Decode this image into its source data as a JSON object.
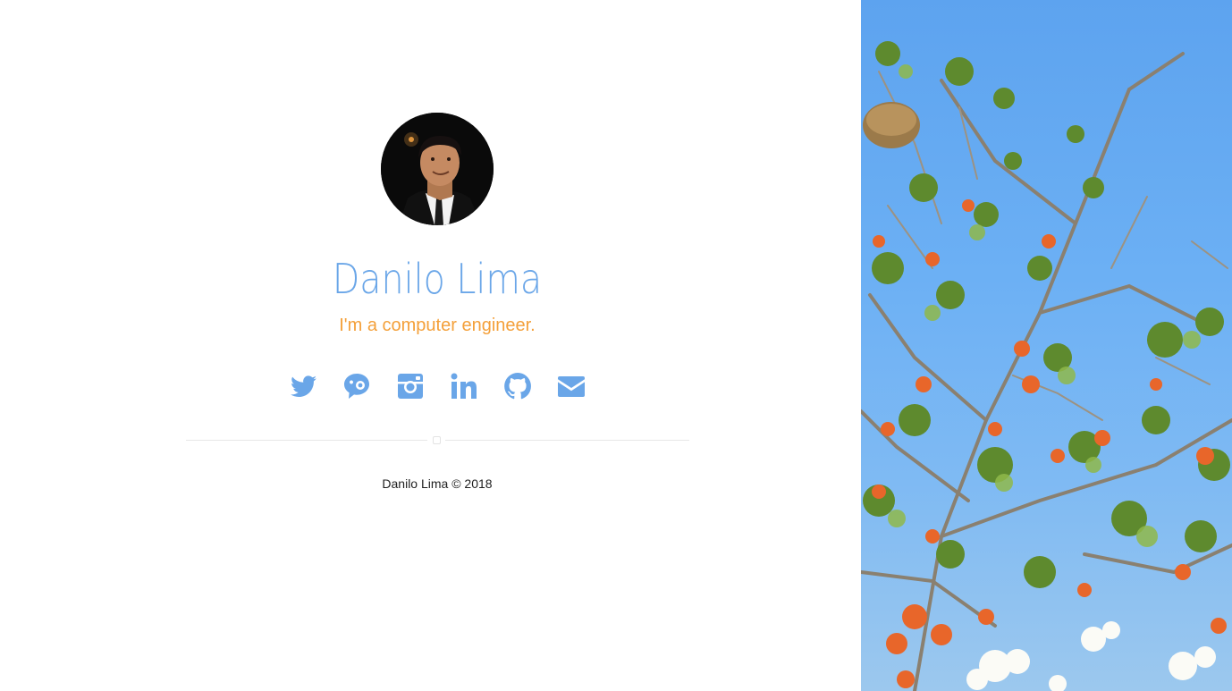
{
  "profile": {
    "name": "Danilo Lima",
    "tagline": "I'm a computer engineer.",
    "avatar_icon": "profile-photo"
  },
  "social": [
    {
      "name": "twitter",
      "icon": "twitter-icon"
    },
    {
      "name": "keybase",
      "icon": "keybase-icon"
    },
    {
      "name": "instagram",
      "icon": "instagram-icon"
    },
    {
      "name": "linkedin",
      "icon": "linkedin-icon"
    },
    {
      "name": "github",
      "icon": "github-icon"
    },
    {
      "name": "email",
      "icon": "envelope-icon"
    }
  ],
  "footer": {
    "text": "Danilo Lima © 2018"
  },
  "colors": {
    "accent": "#6aa6e8",
    "tagline": "#f4a03a",
    "sky": "#5da3ef"
  }
}
